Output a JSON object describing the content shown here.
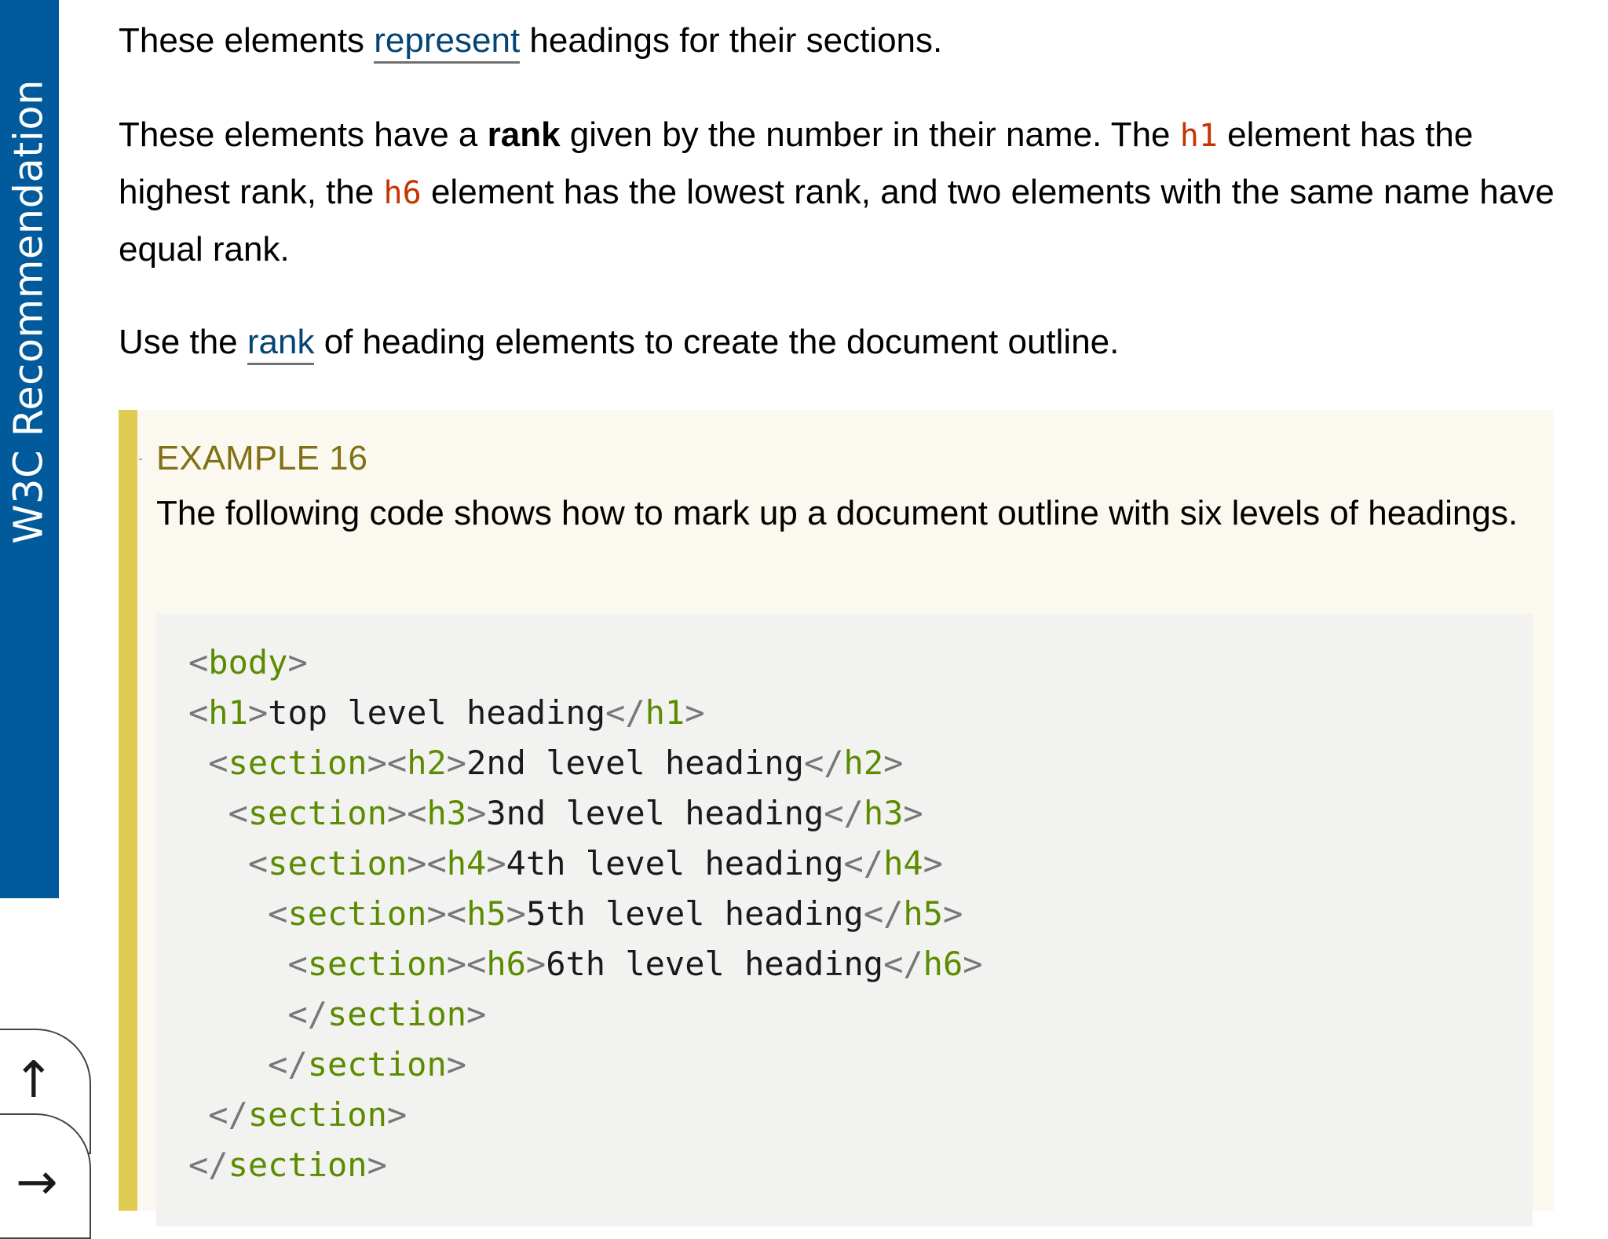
{
  "sidebar": {
    "badge_label": "W3C Recommendation"
  },
  "content": {
    "p1": {
      "before": "These elements ",
      "link": "represent",
      "after": " headings for their sections."
    },
    "p2": {
      "s1": "These elements have a ",
      "bold": "rank",
      "s2": " given by the number in their name. The ",
      "h1": "h1",
      "s3": " element has the highest rank, the ",
      "h6": "h6",
      "s4": " element has the lowest rank, and two elements with the same name have equal rank."
    },
    "p3": {
      "before": "Use the ",
      "link": "rank",
      "after": " of heading elements to create the document outline."
    },
    "example": {
      "title": "EXAMPLE 16",
      "description": "The following code shows how to mark up a document outline with six levels of headings.",
      "code": [
        {
          "indent": "",
          "open": "body",
          "text": "",
          "close": ""
        },
        {
          "indent": "",
          "open": "h1",
          "text": "top level heading",
          "close": "h1"
        },
        {
          "indent": " ",
          "section": true,
          "open": "h2",
          "text": "2nd level heading",
          "close": "h2"
        },
        {
          "indent": "  ",
          "section": true,
          "open": "h3",
          "text": "3nd level heading",
          "close": "h3"
        },
        {
          "indent": "   ",
          "section": true,
          "open": "h4",
          "text": "4th level heading",
          "close": "h4"
        },
        {
          "indent": "    ",
          "section": true,
          "open": "h5",
          "text": "5th level heading",
          "close": "h5"
        },
        {
          "indent": "     ",
          "section": true,
          "open": "h6",
          "text": "6th level heading",
          "close": "h6"
        },
        {
          "indent": "     ",
          "end": "section"
        },
        {
          "indent": "    ",
          "end": "section"
        },
        {
          "indent": " ",
          "end": "section"
        },
        {
          "indent": "",
          "end": "section"
        }
      ]
    }
  },
  "nav": {
    "back_to_top_icon": "arrow-up-icon",
    "next_icon": "arrow-right-icon",
    "up_glyph": "↑",
    "right_glyph": "→"
  },
  "colors": {
    "badge": "#005a9c",
    "link": "#034575",
    "code_ref": "#c63501",
    "example_border": "#e0cb52",
    "example_title": "#827017",
    "tag": "#5b8c00"
  }
}
